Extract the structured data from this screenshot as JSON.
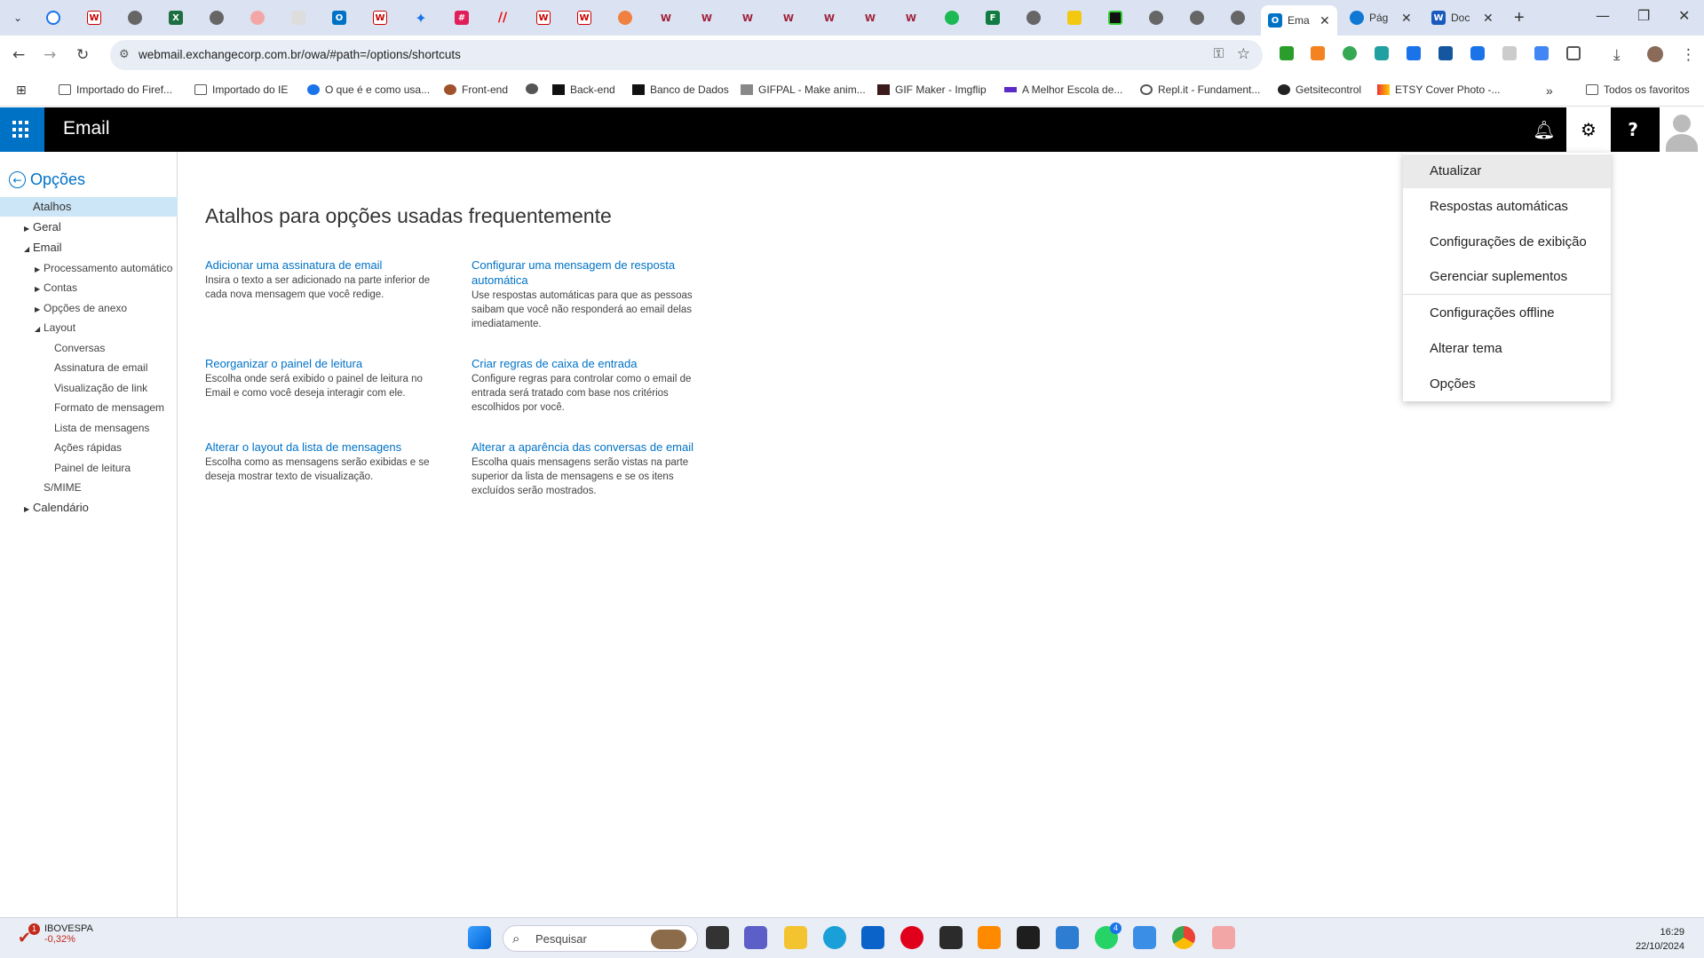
{
  "browser": {
    "tabs_active_label": "Ema",
    "tab_2_label": "Pág",
    "tab_3_label": "Doc",
    "url": "webmail.exchangecorp.com.br/owa/#path=/options/shortcuts",
    "bookmarks": [
      "Importado do Firef...",
      "Importado do IE",
      "O que é e como usa...",
      "Front-end",
      "Back-end",
      "Banco de Dados",
      "GIFPAL - Make anim...",
      "GIF Maker - Imgflip",
      "A Melhor Escola de...",
      "Repl.it - Fundament...",
      "Getsitecontrol",
      "ETSY Cover Photo -..."
    ],
    "all_bookmarks": "Todos os favoritos"
  },
  "owa": {
    "app_name": "Email",
    "back_label": "Opções",
    "accent": "#0072c6"
  },
  "nav": {
    "shortcuts": "Atalhos",
    "general": "Geral",
    "email": "Email",
    "auto_processing": "Processamento automático",
    "accounts": "Contas",
    "attachment_options": "Opções de anexo",
    "layout": "Layout",
    "conversations": "Conversas",
    "email_signature": "Assinatura de email",
    "link_preview": "Visualização de link",
    "message_format": "Formato de mensagem",
    "message_list": "Lista de mensagens",
    "quick_actions": "Ações rápidas",
    "reading_pane": "Painel de leitura",
    "smime": "S/MIME",
    "calendar": "Calendário"
  },
  "main": {
    "title": "Atalhos para opções usadas frequentemente",
    "shortcuts": [
      {
        "title": "Adicionar uma assinatura de email",
        "desc": "Insira o texto a ser adicionado na parte inferior de cada nova mensagem que você redige."
      },
      {
        "title": "Configurar uma mensagem de resposta automática",
        "desc": "Use respostas automáticas para que as pessoas saibam que você não responderá ao email delas imediatamente."
      },
      {
        "title": "Reorganizar o painel de leitura",
        "desc": "Escolha onde será exibido o painel de leitura no Email e como você deseja interagir com ele."
      },
      {
        "title": "Criar regras de caixa de entrada",
        "desc": "Configure regras para controlar como o email de entrada será tratado com base nos critérios escolhidos por você."
      },
      {
        "title": "Alterar o layout da lista de mensagens",
        "desc": "Escolha como as mensagens serão exibidas e se deseja mostrar texto de visualização."
      },
      {
        "title": "Alterar a aparência das conversas de email",
        "desc": "Escolha quais mensagens serão vistas na parte superior da lista de mensagens e se os itens excluídos serão mostrados."
      }
    ]
  },
  "settings_menu": {
    "items": [
      "Atualizar",
      "Respostas automáticas",
      "Configurações de exibição",
      "Gerenciar suplementos",
      "Configurações offline",
      "Alterar tema",
      "Opções"
    ]
  },
  "taskbar": {
    "stock_name": "IBOVESPA",
    "stock_change": "-0,32%",
    "stock_badge": "1",
    "search_placeholder": "Pesquisar",
    "whatsapp_badge": "4",
    "time": "16:29",
    "date": "22/10/2024"
  }
}
